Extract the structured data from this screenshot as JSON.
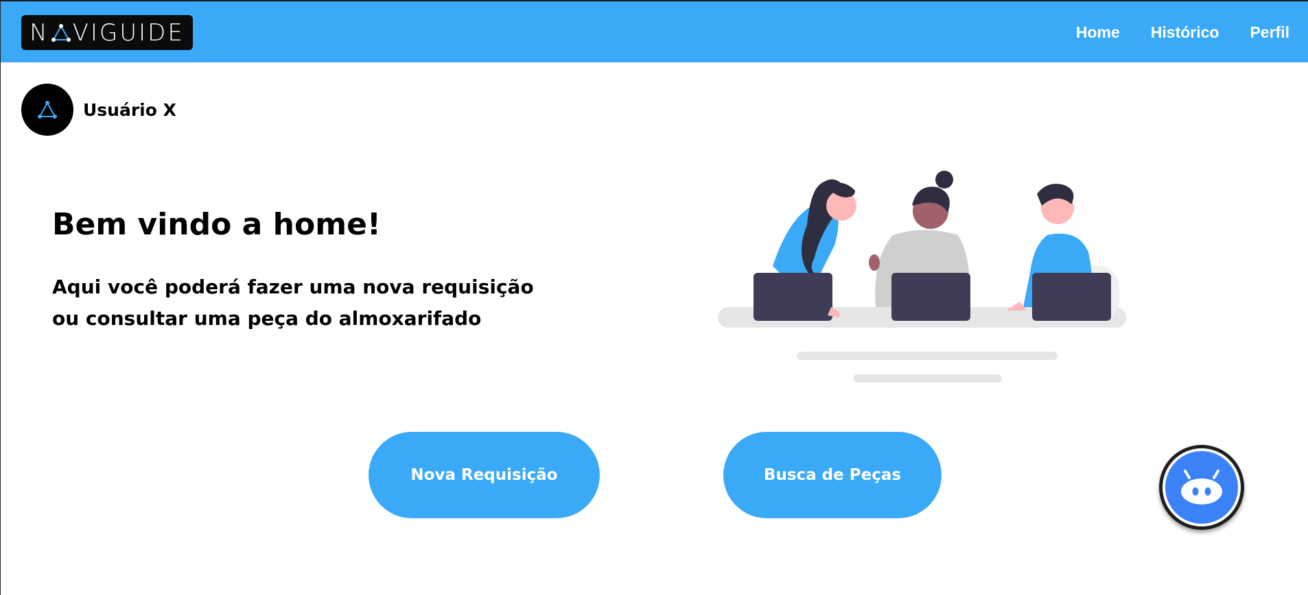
{
  "header": {
    "logo_text_pre": "N",
    "logo_text_post": "VIGUIDE",
    "nav": [
      {
        "label": "Home"
      },
      {
        "label": "Histórico"
      },
      {
        "label": "Perfil"
      }
    ]
  },
  "user": {
    "name": "Usuário X"
  },
  "main": {
    "title": "Bem vindo a home!",
    "subtitle_line1": "Aqui você poderá fazer uma nova requisição",
    "subtitle_line2": "ou consultar uma peça do almoxarifado"
  },
  "actions": {
    "nova_requisicao": "Nova Requisição",
    "busca_pecas": "Busca de Peças"
  },
  "colors": {
    "accent": "#3aa9f8",
    "bot_face": "#3b82f6",
    "laptop": "#3f3d56",
    "hair": "#2f2e41"
  },
  "icons": {
    "logo_mark": "triangle-network-icon",
    "avatar": "triangle-network-icon",
    "chatbot": "robot-icon"
  }
}
